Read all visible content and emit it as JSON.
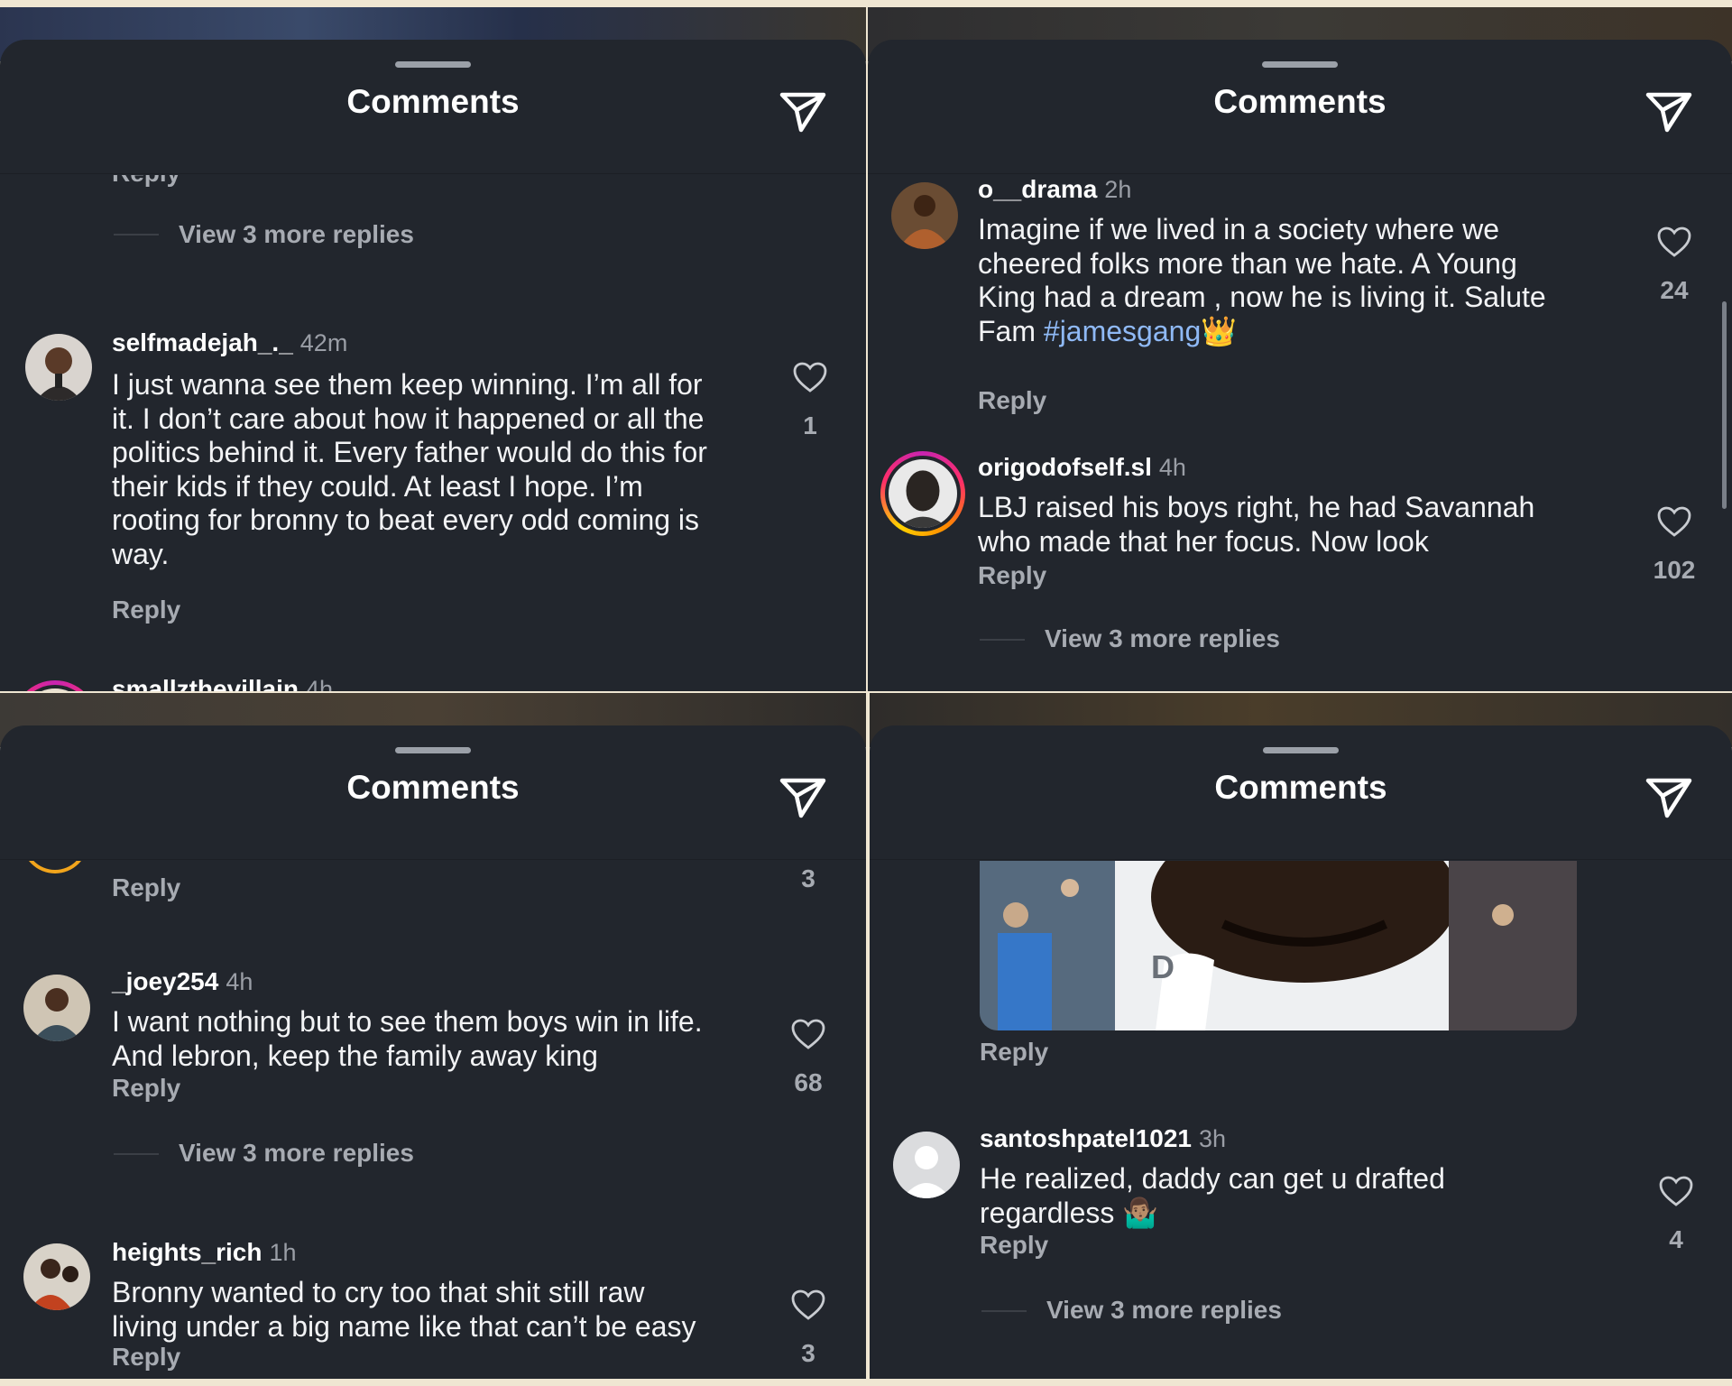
{
  "header": {
    "title": "Comments"
  },
  "panels": [
    {
      "top_partial_reply": "Reply",
      "view_more_1": "View 3 more replies",
      "comments": [
        {
          "username": "selfmadejah_._",
          "time": "42m",
          "lines": [
            "I just wanna see them keep winning. I’m all for",
            "it. I don’t care about how it happened or all the",
            "politics behind it. Every father would do this for",
            "their kids if they could. At least I hope. I’m",
            "rooting for bronny to beat every odd coming is",
            "way."
          ],
          "reply": "Reply",
          "likes": "1"
        },
        {
          "username": "smallzthevillain",
          "time": "4h",
          "emoji": "❤️💪💯🙏🚀"
        }
      ]
    },
    {
      "comments": [
        {
          "username": "o__drama",
          "time": "2h",
          "lines": [
            "Imagine if we lived in a society where we",
            "cheered folks more than we hate.  A Young",
            "King had a dream , now he is living it. Salute"
          ],
          "last_line_prefix": "Fam ",
          "hashtag": "#jamesgang",
          "emoji": "👑",
          "reply": "Reply",
          "likes": "24"
        },
        {
          "username": "origodofself.sl",
          "time": "4h",
          "lines": [
            "LBJ raised his boys right, he had Savannah",
            "who made that her focus. Now look"
          ],
          "reply": "Reply",
          "likes": "102",
          "view_more": "View 3 more replies"
        }
      ]
    },
    {
      "top_reply": "Reply",
      "top_likes": "3",
      "comments": [
        {
          "username": "_joey254",
          "time": "4h",
          "lines": [
            "I want nothing but to see them boys win in life.",
            "And lebron, keep the family away king"
          ],
          "reply": "Reply",
          "likes": "68",
          "view_more": "View 3 more replies"
        },
        {
          "username": "heights_rich",
          "time": "1h",
          "lines": [
            "Bronny wanted to cry too that shit still raw",
            "living under a big name like that can’t be easy"
          ],
          "reply": "Reply",
          "likes": "3"
        }
      ]
    },
    {
      "gif_reply": "Reply",
      "comments": [
        {
          "username": "santoshpatel1021",
          "time": "3h",
          "lines": [
            "He realized, daddy can get u drafted"
          ],
          "last_line_prefix": "regardless ",
          "emoji": "🤷🏽‍♂️",
          "reply": "Reply",
          "likes": "4",
          "view_more": "View 3 more replies"
        }
      ]
    }
  ],
  "icons": {
    "send": "paper-plane-icon",
    "heart": "heart-outline-icon",
    "avatar_placeholder": "default-avatar-icon"
  },
  "colors": {
    "sheet_bg": "#22262d",
    "text": "#f2f3f5",
    "muted": "#a7abb2",
    "hashtag": "#8fb9f5"
  }
}
